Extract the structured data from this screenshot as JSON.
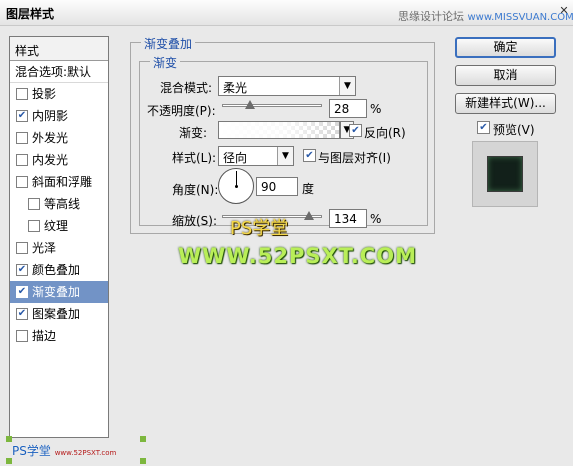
{
  "window": {
    "title": "图层样式",
    "watermark_text": "思缘设计论坛",
    "watermark_url": "www.MISSVUAN.COM",
    "close_glyph": "✕"
  },
  "style_list": {
    "header": "样式",
    "top_item": "混合选项:默认",
    "items": [
      {
        "label": "投影",
        "checked": false,
        "indent": false,
        "selected": false
      },
      {
        "label": "内阴影",
        "checked": true,
        "indent": false,
        "selected": false
      },
      {
        "label": "外发光",
        "checked": false,
        "indent": false,
        "selected": false
      },
      {
        "label": "内发光",
        "checked": false,
        "indent": false,
        "selected": false
      },
      {
        "label": "斜面和浮雕",
        "checked": false,
        "indent": false,
        "selected": false
      },
      {
        "label": "等高线",
        "checked": false,
        "indent": true,
        "selected": false
      },
      {
        "label": "纹理",
        "checked": false,
        "indent": true,
        "selected": false
      },
      {
        "label": "光泽",
        "checked": false,
        "indent": false,
        "selected": false
      },
      {
        "label": "颜色叠加",
        "checked": true,
        "indent": false,
        "selected": false
      },
      {
        "label": "渐变叠加",
        "checked": true,
        "indent": false,
        "selected": true
      },
      {
        "label": "图案叠加",
        "checked": true,
        "indent": false,
        "selected": false
      },
      {
        "label": "描边",
        "checked": false,
        "indent": false,
        "selected": false
      }
    ]
  },
  "panel": {
    "group_title": "渐变叠加",
    "subgroup_title": "渐变",
    "blend_mode": {
      "label": "混合模式:",
      "value": "柔光"
    },
    "opacity": {
      "label": "不透明度(P):",
      "value": "28",
      "unit": "%",
      "level": 0.28
    },
    "gradient": {
      "label": "渐变:",
      "reverse_label": "反向(R)",
      "reverse_checked": true
    },
    "style": {
      "label": "样式(L):",
      "value": "径向",
      "align_label": "与图层对齐(I)",
      "align_checked": true
    },
    "angle": {
      "label": "角度(N):",
      "value": "90",
      "unit": "度"
    },
    "scale": {
      "label": "缩放(S):",
      "value": "134",
      "unit": "%"
    }
  },
  "buttons": {
    "ok": "确定",
    "cancel": "取消",
    "new_style": "新建样式(W)...",
    "preview_label": "预览(V)",
    "preview_checked": true
  },
  "watermarks": {
    "center_top": "PS学堂",
    "center_url": "WWW.52PSXT.COM",
    "bottom_left": "PS学堂",
    "bottom_left_url": "www.52PSXT.com"
  },
  "colors": {
    "selection": "#7293c6",
    "legend_text": "#1f4fa8",
    "default_button_border": "#3a6fbe"
  }
}
